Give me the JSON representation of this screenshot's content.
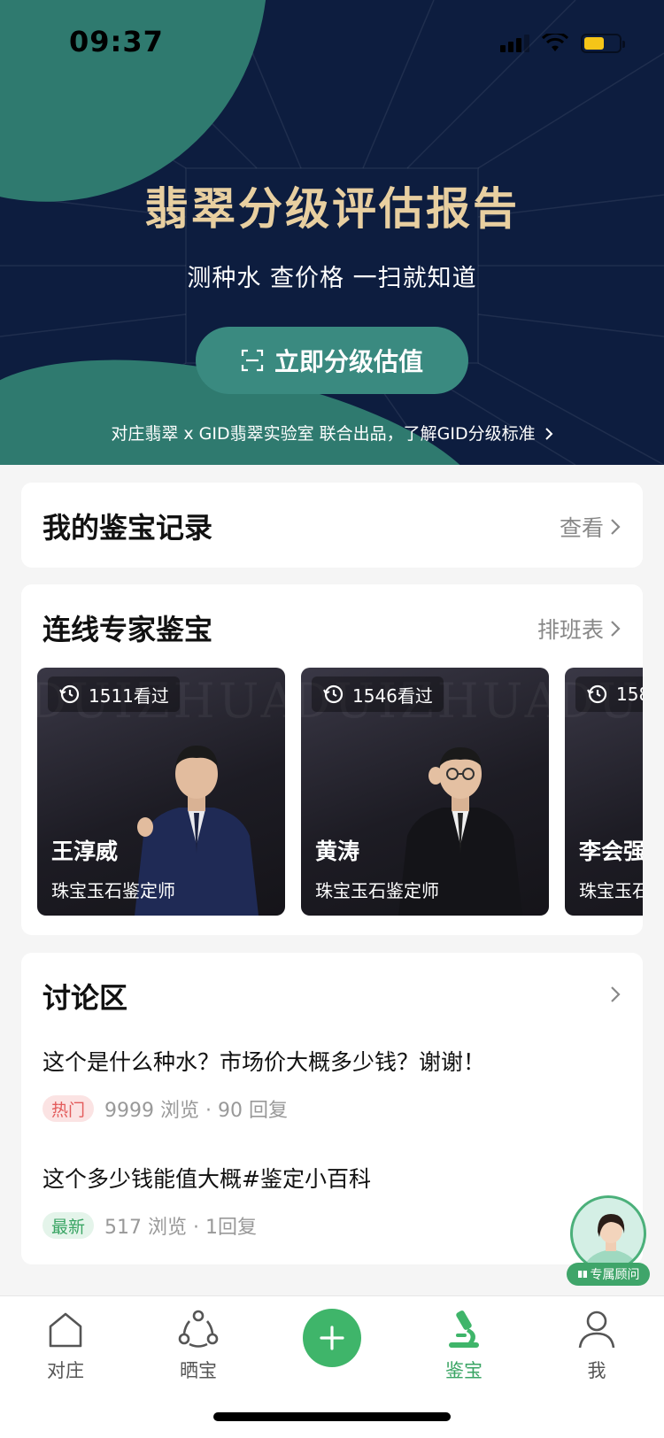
{
  "status_bar": {
    "time": "09:37"
  },
  "hero": {
    "title": "翡翠分级评估报告",
    "subtitle": "测种水 查价格 一扫就知道",
    "button_label": "立即分级估值",
    "note": "对庄翡翠 x GID翡翠实验室 联合出品，了解GID分级标准"
  },
  "records": {
    "title": "我的鉴宝记录",
    "link": "查看"
  },
  "experts": {
    "title": "连线专家鉴宝",
    "link": "排班表",
    "watermark": "DUIZHUANG",
    "items": [
      {
        "views": "1511看过",
        "name": "王淳威",
        "role": "珠宝玉石鉴定师"
      },
      {
        "views": "1546看过",
        "name": "黄涛",
        "role": "珠宝玉石鉴定师"
      },
      {
        "views": "158",
        "name": "李会强",
        "role": "珠宝玉石鉴定师"
      }
    ]
  },
  "discussion": {
    "title": "讨论区",
    "posts": [
      {
        "title": "这个是什么种水？市场价大概多少钱？谢谢！",
        "tag": "热门",
        "meta": "9999 浏览 · 90 回复"
      },
      {
        "title": "这个多少钱能值大概#鉴定小百科",
        "tag": "最新",
        "meta": "517 浏览 · 1回复"
      }
    ]
  },
  "advisor": {
    "label": "专属顾问"
  },
  "tabbar": {
    "items": [
      {
        "label": "对庄",
        "icon": "home-icon"
      },
      {
        "label": "晒宝",
        "icon": "share-icon"
      },
      {
        "label": "",
        "icon": "plus-icon"
      },
      {
        "label": "鉴宝",
        "icon": "microscope-icon"
      },
      {
        "label": "我",
        "icon": "person-icon"
      }
    ]
  },
  "colors": {
    "accent": "#3fb56a",
    "hero_bg": "#0d1d3f",
    "hero_teal": "#2f7a6f",
    "gold": "#e8cfa0"
  }
}
